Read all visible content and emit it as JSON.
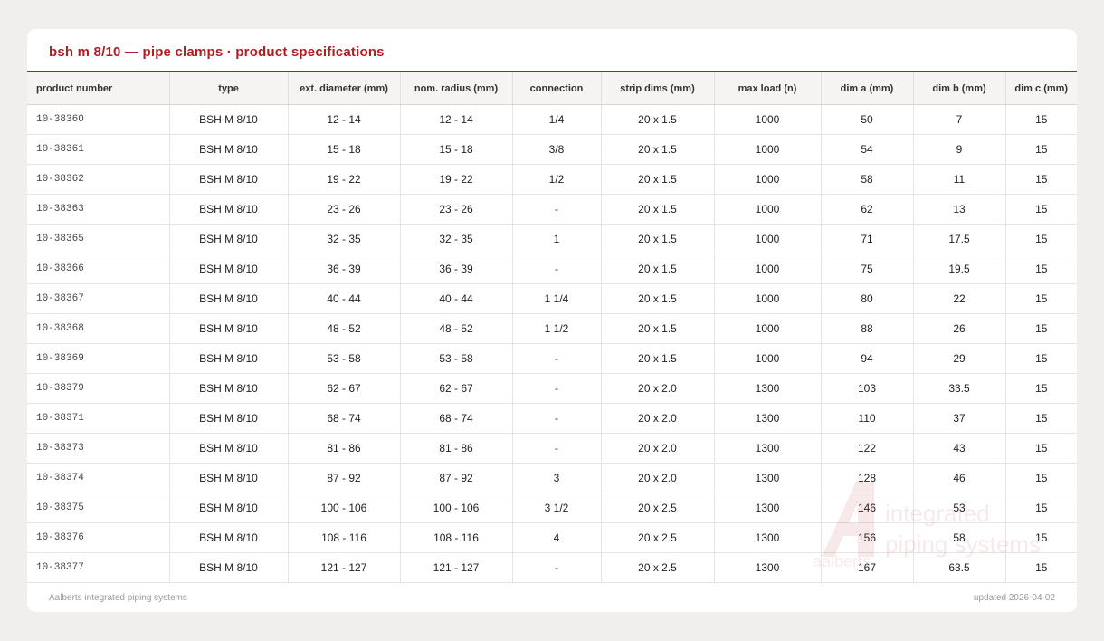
{
  "page": {
    "title": "bsh m 8/10 — pipe clamps · product specifications"
  },
  "table": {
    "headers": [
      "product number",
      "type",
      "ext. diameter (mm)",
      "nom. radius (mm)",
      "connection",
      "strip dims (mm)",
      "max load (n)",
      "dim a (mm)",
      "dim b (mm)",
      "dim c (mm)"
    ],
    "rows": [
      [
        "10-38360",
        "BSH M 8/10",
        "12 - 14",
        "12 - 14",
        "1/4",
        "20 x 1.5",
        "1000",
        "50",
        "7",
        "15"
      ],
      [
        "10-38361",
        "BSH M 8/10",
        "15 - 18",
        "15 - 18",
        "3/8",
        "20 x 1.5",
        "1000",
        "54",
        "9",
        "15"
      ],
      [
        "10-38362",
        "BSH M 8/10",
        "19 - 22",
        "19 - 22",
        "1/2",
        "20 x 1.5",
        "1000",
        "58",
        "11",
        "15"
      ],
      [
        "10-38363",
        "BSH M 8/10",
        "23 - 26",
        "23 - 26",
        "-",
        "20 x 1.5",
        "1000",
        "62",
        "13",
        "15"
      ],
      [
        "10-38365",
        "BSH M 8/10",
        "32 - 35",
        "32 - 35",
        "1",
        "20 x 1.5",
        "1000",
        "71",
        "17.5",
        "15"
      ],
      [
        "10-38366",
        "BSH M 8/10",
        "36 - 39",
        "36 - 39",
        "-",
        "20 x 1.5",
        "1000",
        "75",
        "19.5",
        "15"
      ],
      [
        "10-38367",
        "BSH M 8/10",
        "40 - 44",
        "40 - 44",
        "1 1/4",
        "20 x 1.5",
        "1000",
        "80",
        "22",
        "15"
      ],
      [
        "10-38368",
        "BSH M 8/10",
        "48 - 52",
        "48 - 52",
        "1 1/2",
        "20 x 1.5",
        "1000",
        "88",
        "26",
        "15"
      ],
      [
        "10-38369",
        "BSH M 8/10",
        "53 - 58",
        "53 - 58",
        "-",
        "20 x 1.5",
        "1000",
        "94",
        "29",
        "15"
      ],
      [
        "10-38379",
        "BSH M 8/10",
        "62 - 67",
        "62 - 67",
        "-",
        "20 x 2.0",
        "1300",
        "103",
        "33.5",
        "15"
      ],
      [
        "10-38371",
        "BSH M 8/10",
        "68 - 74",
        "68 - 74",
        "-",
        "20 x 2.0",
        "1300",
        "110",
        "37",
        "15"
      ],
      [
        "10-38373",
        "BSH M 8/10",
        "81 - 86",
        "81 - 86",
        "-",
        "20 x 2.0",
        "1300",
        "122",
        "43",
        "15"
      ],
      [
        "10-38374",
        "BSH M 8/10",
        "87 - 92",
        "87 - 92",
        "3",
        "20 x 2.0",
        "1300",
        "128",
        "46",
        "15"
      ],
      [
        "10-38375",
        "BSH M 8/10",
        "100 - 106",
        "100 - 106",
        "3 1/2",
        "20 x 2.5",
        "1300",
        "146",
        "53",
        "15"
      ],
      [
        "10-38376",
        "BSH M 8/10",
        "108 - 116",
        "108 - 116",
        "4",
        "20 x 2.5",
        "1300",
        "156",
        "58",
        "15"
      ],
      [
        "10-38377",
        "BSH M 8/10",
        "121 - 127",
        "121 - 127",
        "-",
        "20 x 2.5",
        "1300",
        "167",
        "63.5",
        "15"
      ]
    ]
  },
  "watermark": {
    "logo_text": "aalberts",
    "tagline_line1": "integrated",
    "tagline_line2": "piping systems",
    "color": "#b01c22"
  },
  "footer": {
    "left": "Aalberts integrated piping systems",
    "right": "updated 2026-04-02"
  },
  "colors": {
    "accent": "#b01c22",
    "background": "#f0efed",
    "card": "#ffffff"
  }
}
